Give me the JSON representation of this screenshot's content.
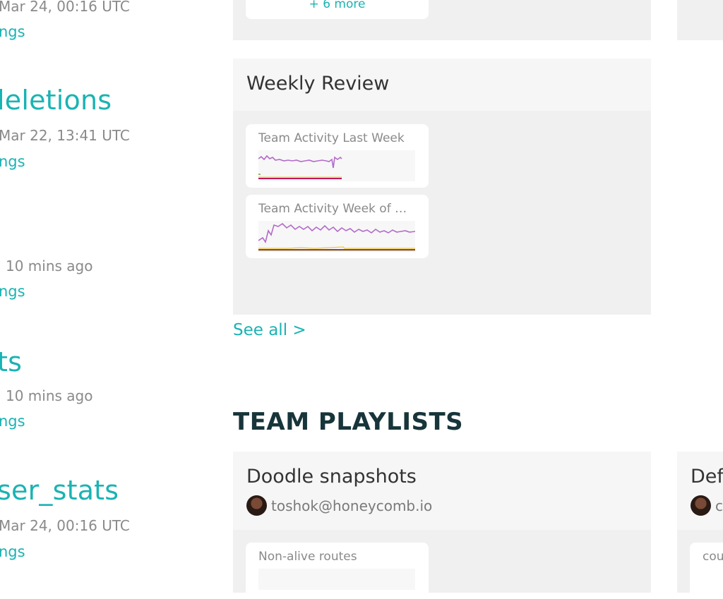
{
  "left_column": {
    "items": [
      {
        "meta": "Mar 24, 00:16 UTC",
        "link": "ngs"
      },
      {
        "title": "leletions",
        "meta": "Mar 22, 13:41 UTC",
        "link": "ngs"
      },
      {
        "meta": "10 mins ago",
        "link": "ngs"
      },
      {
        "title": "ts",
        "meta": "10 mins ago",
        "link": "ngs"
      },
      {
        "title": "ser_stats",
        "meta": "Mar 24, 00:16 UTC",
        "link": "ngs"
      }
    ]
  },
  "top_panel": {
    "more_link": "+ 6 more"
  },
  "weekly_review": {
    "title": "Weekly Review",
    "cards": [
      {
        "title": "Team Activity Last Week"
      },
      {
        "title": "Team Activity Week of 20..."
      }
    ],
    "see_all": "See all >"
  },
  "team_playlists": {
    "heading": "TEAM PLAYLISTS",
    "playlists": [
      {
        "title": "Doodle snapshots",
        "owner": "toshok@honeycomb.io",
        "card_title": "Non-alive routes"
      },
      {
        "title": "Def",
        "owner": "c",
        "card_title": "cou"
      }
    ]
  },
  "colors": {
    "accent": "#1ab3b3",
    "heading": "#17353a",
    "series_purple": "#b36bc9",
    "series_magenta": "#c2185b",
    "series_green": "#7aa33a",
    "series_yellow": "#f0c93a"
  }
}
